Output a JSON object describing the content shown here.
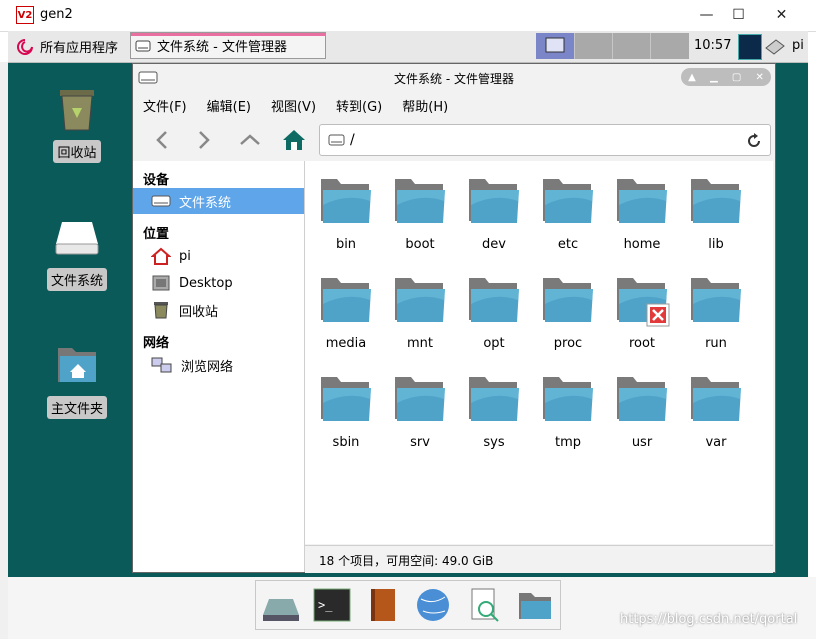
{
  "window": {
    "title": "gen2",
    "app_icon_text": "V2",
    "minimize": "—",
    "maximize": "☐",
    "close": "✕"
  },
  "panel": {
    "menu_label": "所有应用程序",
    "task_label": "文件系统 - 文件管理器",
    "clock": "10:57",
    "user": "pi"
  },
  "desktop_icons": [
    {
      "label": "回收站",
      "icon": "trash-icon"
    },
    {
      "label": "文件系统",
      "icon": "drive-icon"
    },
    {
      "label": "主文件夹",
      "icon": "home-folder-icon"
    }
  ],
  "file_manager": {
    "title": "文件系统 - 文件管理器",
    "menu": [
      "文件(F)",
      "编辑(E)",
      "视图(V)",
      "转到(G)",
      "帮助(H)"
    ],
    "address": "/",
    "sidebar": {
      "devices_header": "设备",
      "devices": [
        {
          "label": "文件系统",
          "icon": "drive-icon",
          "selected": true
        }
      ],
      "places_header": "位置",
      "places": [
        {
          "label": "pi",
          "icon": "home-icon"
        },
        {
          "label": "Desktop",
          "icon": "desktop-icon"
        },
        {
          "label": "回收站",
          "icon": "trash-icon"
        }
      ],
      "network_header": "网络",
      "network": [
        {
          "label": "浏览网络",
          "icon": "network-icon"
        }
      ]
    },
    "files": [
      "bin",
      "boot",
      "dev",
      "etc",
      "home",
      "lib",
      "media",
      "mnt",
      "opt",
      "proc",
      "root",
      "run",
      "sbin",
      "srv",
      "sys",
      "tmp",
      "usr",
      "var"
    ],
    "status": "18 个项目，可用空间: 49.0 GiB"
  },
  "dock": [
    "drive-icon",
    "terminal-icon",
    "book-icon",
    "globe-icon",
    "search-document-icon",
    "folder-icon"
  ],
  "watermark": "https://blog.csdn.net/qortal",
  "colors": {
    "desktop": "#0b5a5a",
    "selection": "#5ea5ea",
    "folder": "#4fa3c9",
    "locked": "#e23a3a"
  }
}
